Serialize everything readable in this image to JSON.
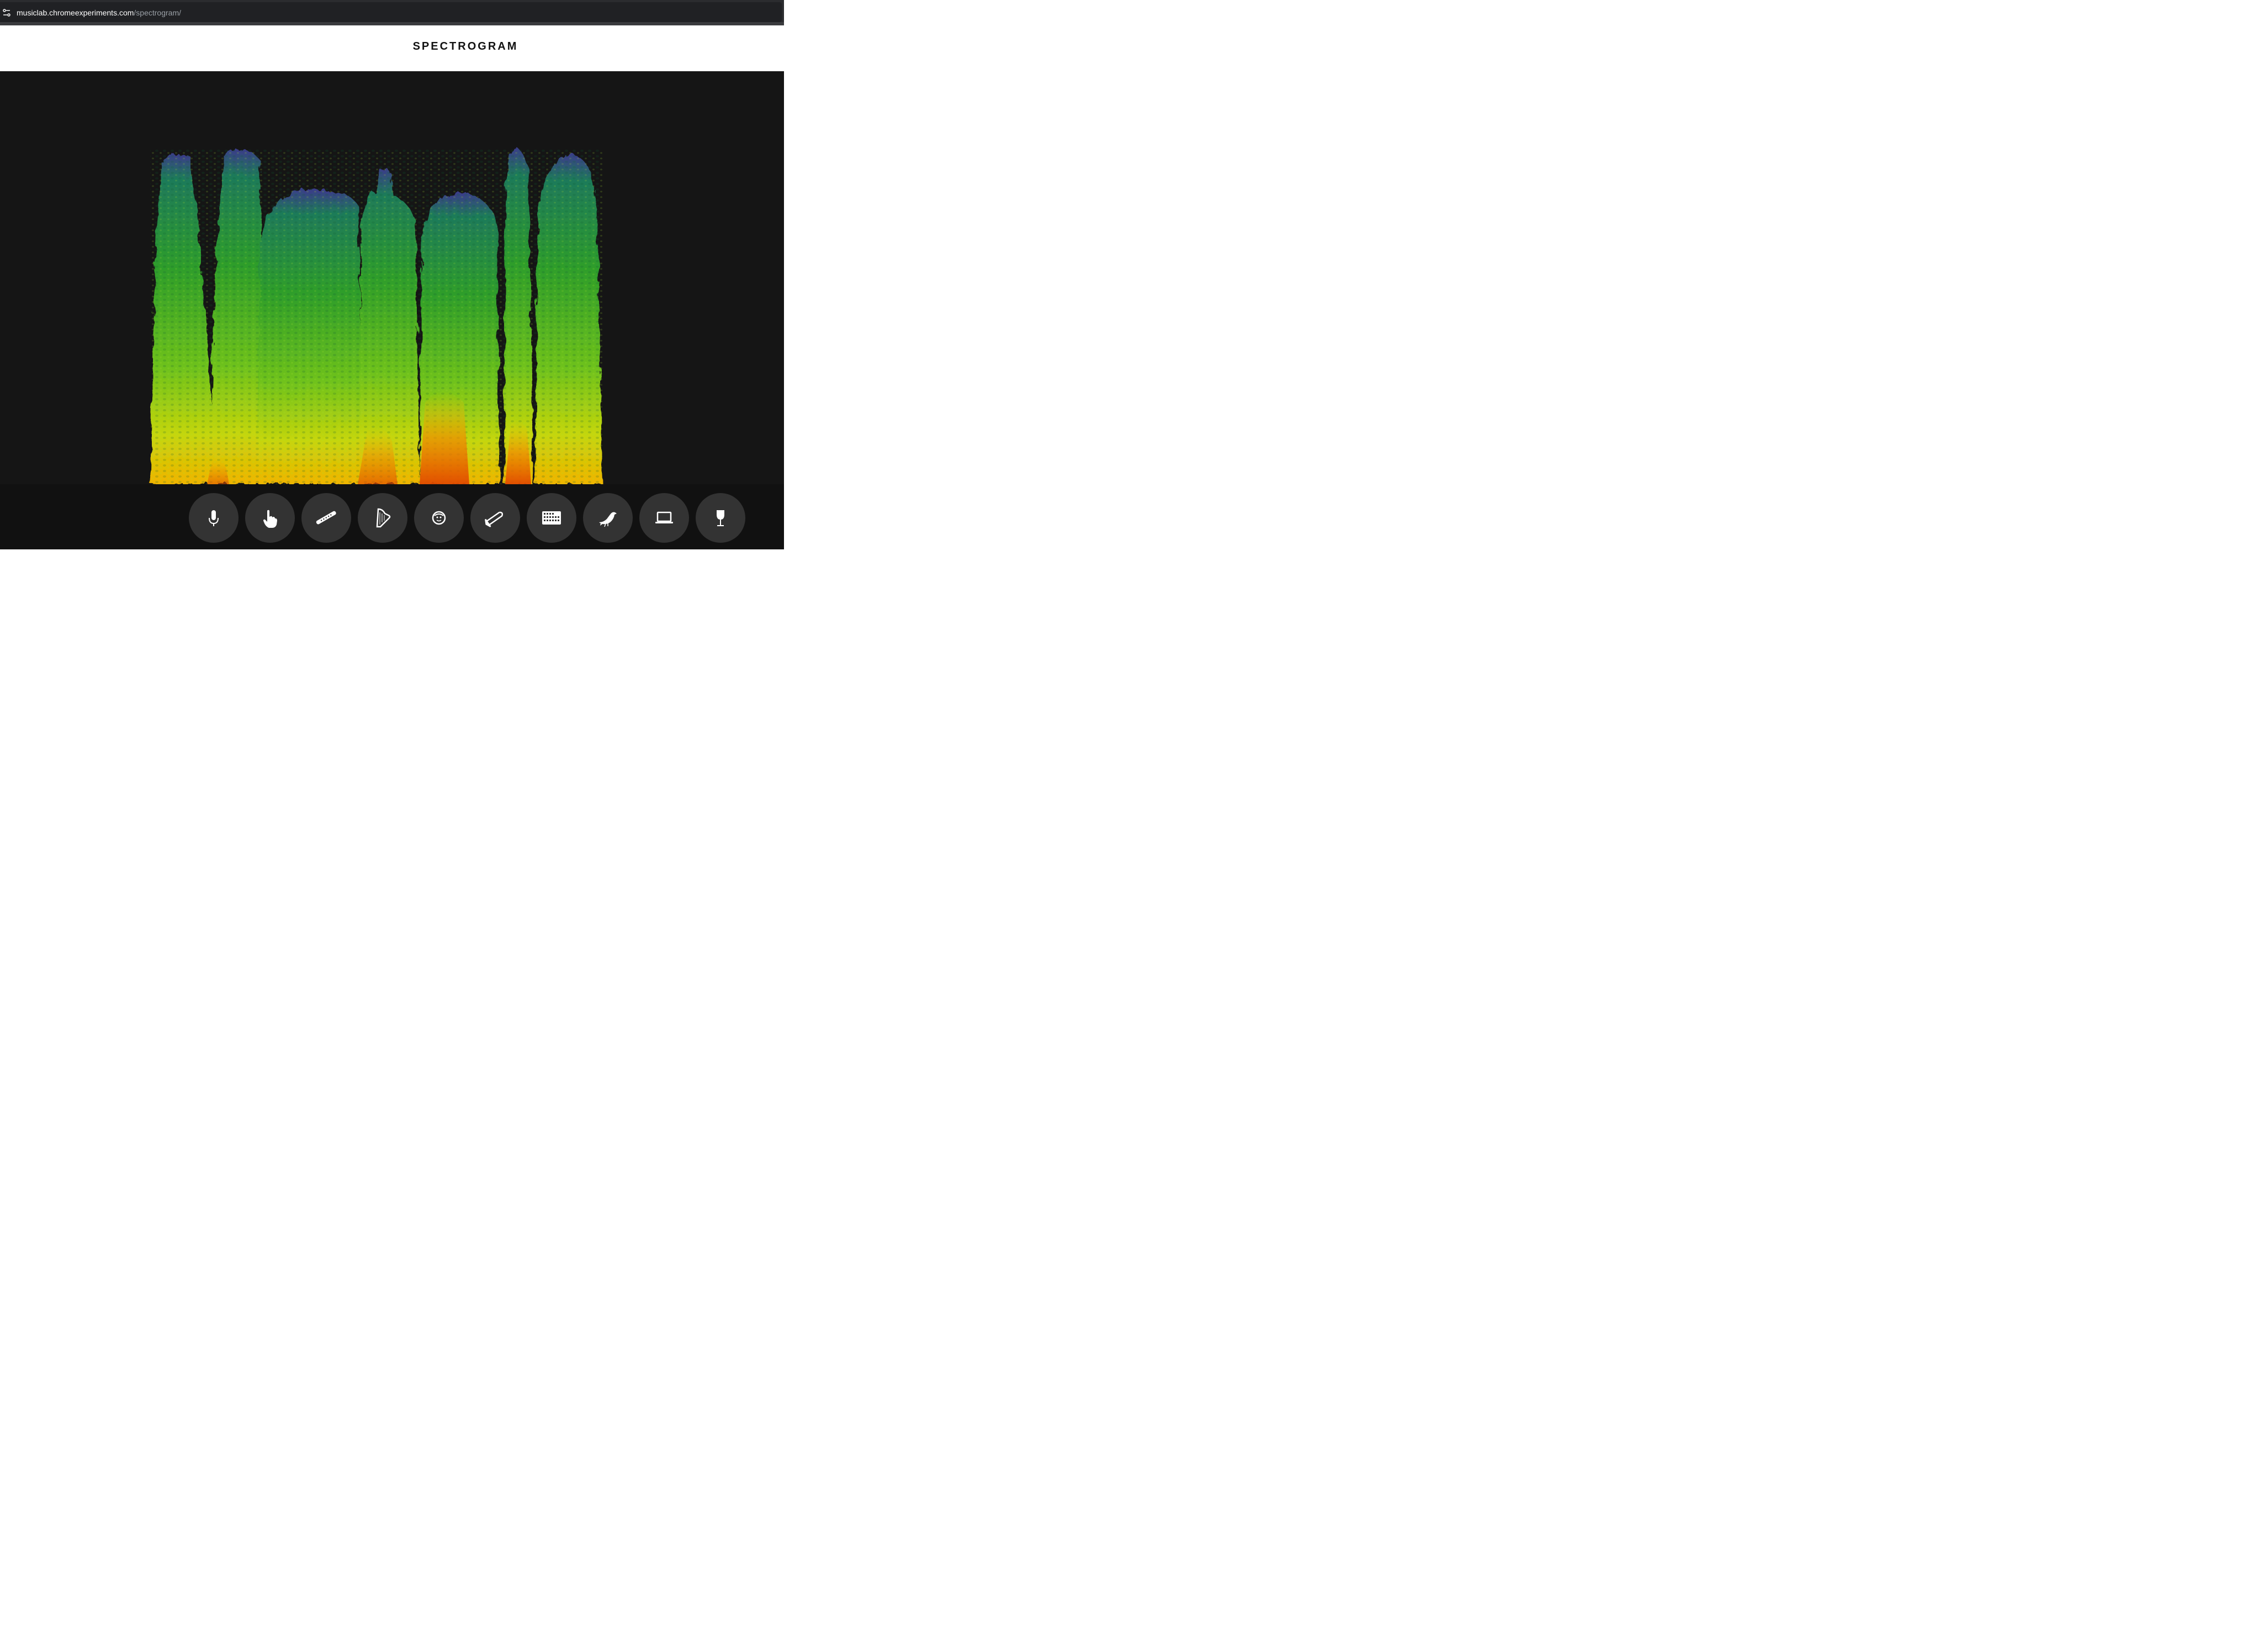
{
  "browser": {
    "url_host": "musiclab.chromeexperiments.com",
    "url_path": "/spectrogram/",
    "tune_icon": "tune-icon"
  },
  "header": {
    "title": "SPECTROGRAM"
  },
  "accent_colors": {
    "background": "#151515",
    "toolbar": "#111111",
    "button": "#333333",
    "spectrogram_low": "#2e7d32",
    "spectrogram_mid": "#7cc31e",
    "spectrogram_high": "#f5c400",
    "spectrogram_peak": "#e85a00"
  },
  "toolbar": {
    "tools": [
      {
        "icon": "microphone-icon"
      },
      {
        "icon": "hand-pointer-icon"
      },
      {
        "icon": "flute-icon"
      },
      {
        "icon": "harp-icon"
      },
      {
        "icon": "face-icon"
      },
      {
        "icon": "trombone-icon"
      },
      {
        "icon": "keyboard-icon"
      },
      {
        "icon": "bird-icon"
      },
      {
        "icon": "laptop-icon"
      },
      {
        "icon": "wine-glass-icon"
      }
    ]
  }
}
